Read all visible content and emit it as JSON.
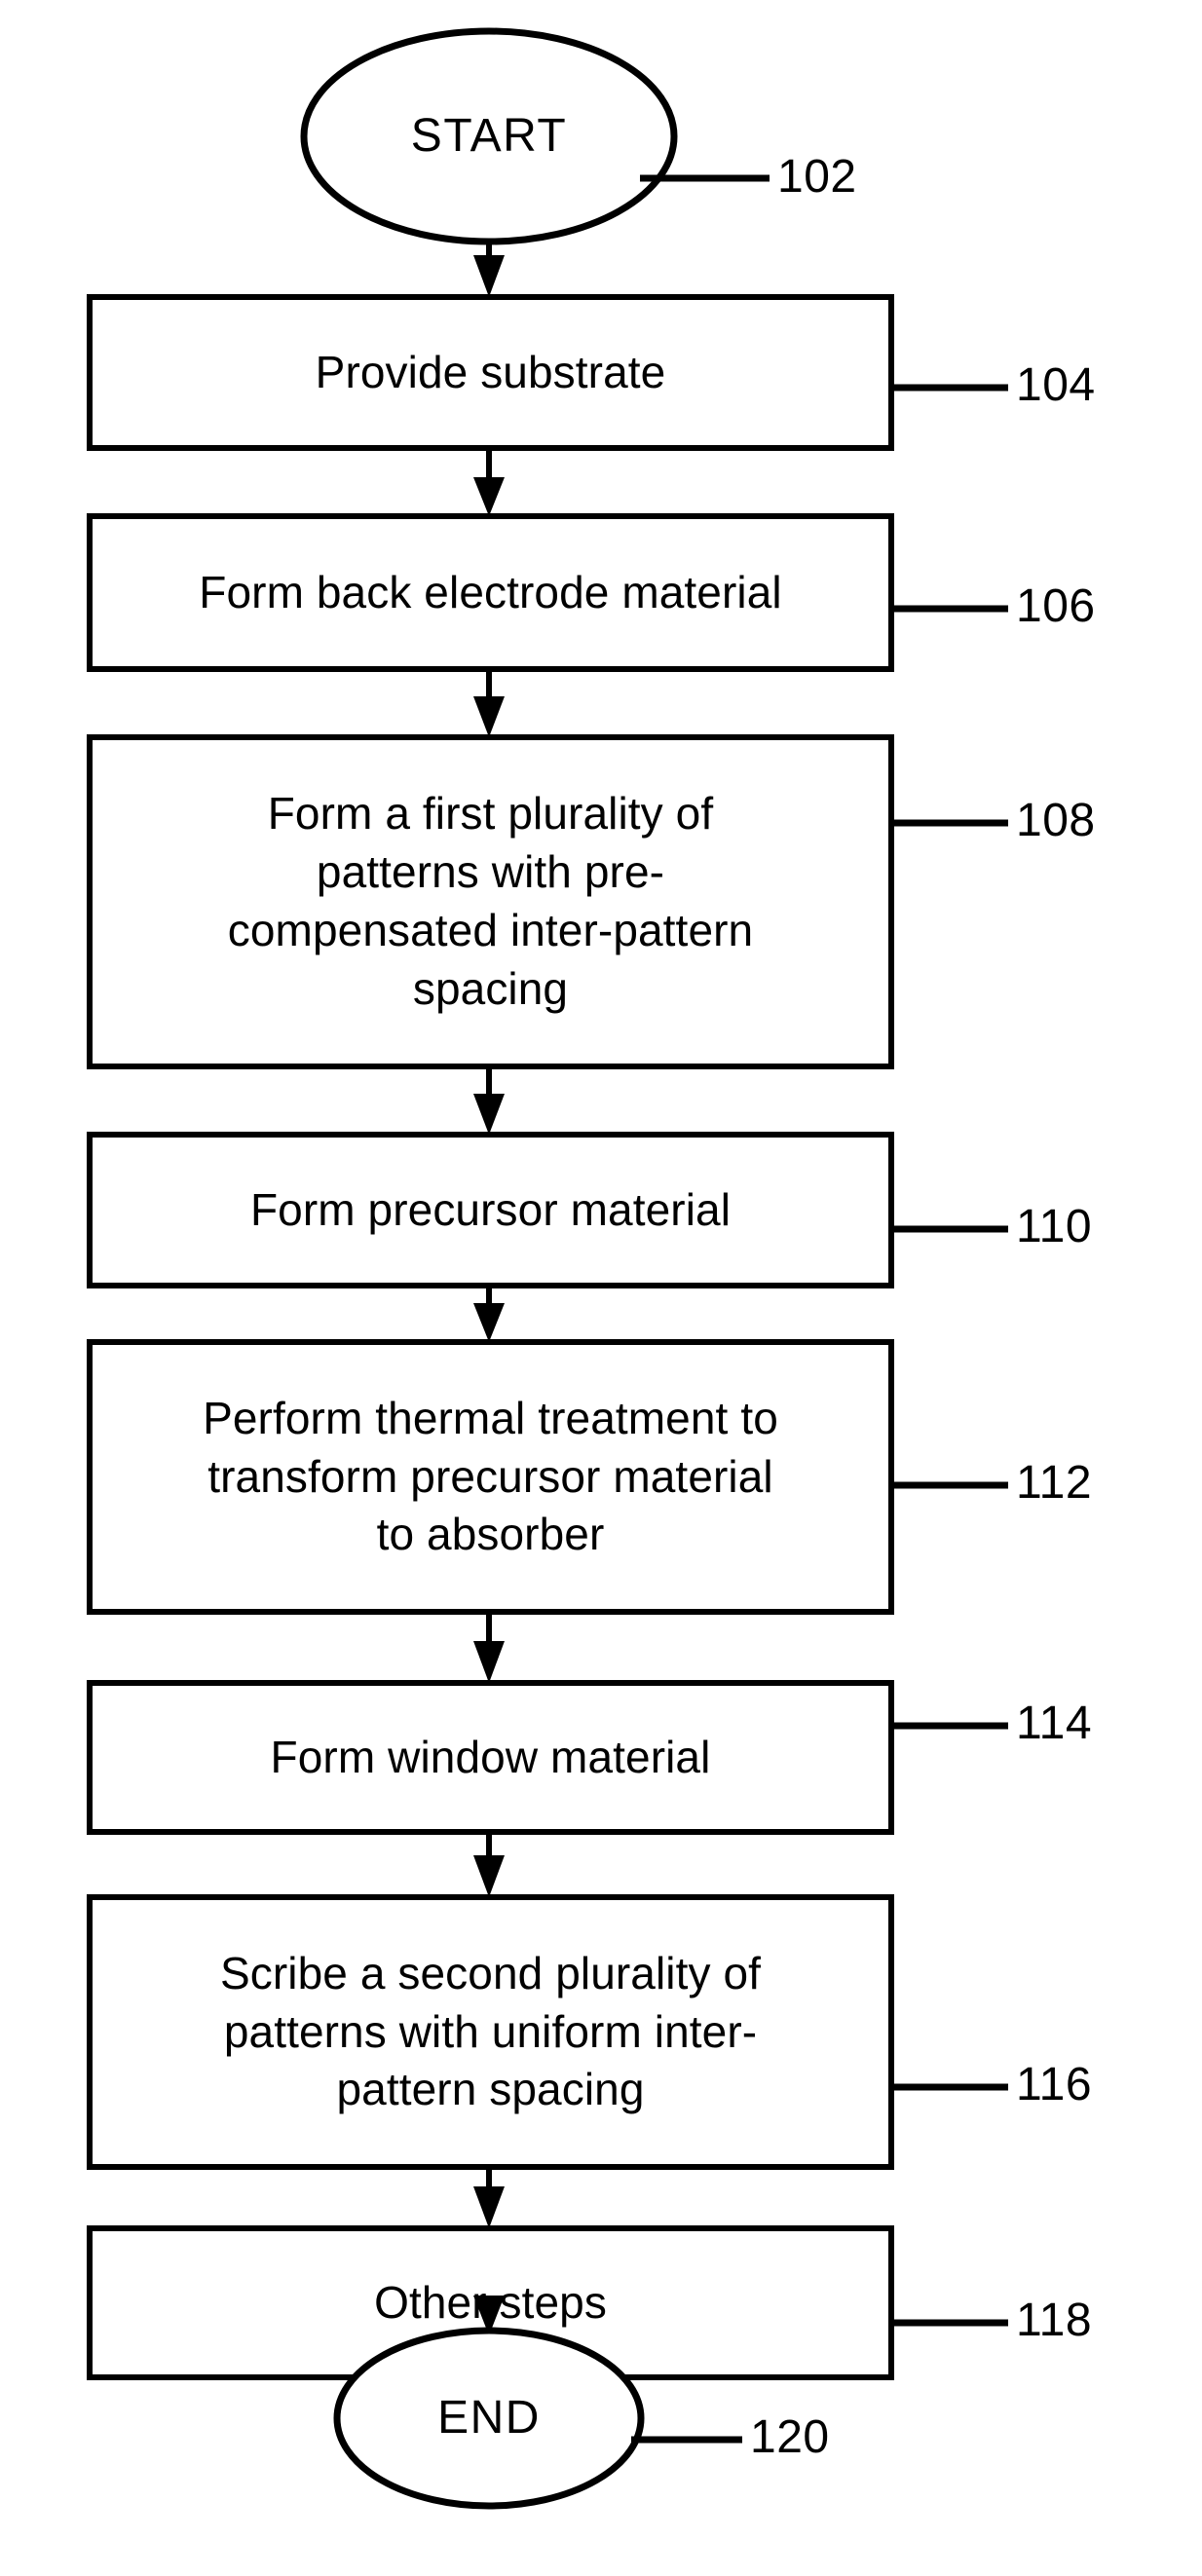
{
  "figure": {
    "type": "process-flowchart",
    "orientation": "vertical-top-to-bottom",
    "background_color": "#ffffff",
    "line_color": "#000000"
  },
  "nodes": [
    {
      "id": "start",
      "shape": "ellipse",
      "label": "START",
      "ref": "102"
    },
    {
      "id": "step-104",
      "shape": "rectangle",
      "label": "Provide substrate",
      "ref": "104"
    },
    {
      "id": "step-106",
      "shape": "rectangle",
      "label": "Form back electrode material",
      "ref": "106"
    },
    {
      "id": "step-108",
      "shape": "rectangle",
      "label": "Form a first plurality of\npatterns with pre-\ncompensated inter-pattern\nspacing",
      "ref": "108"
    },
    {
      "id": "step-110",
      "shape": "rectangle",
      "label": "Form precursor material",
      "ref": "110"
    },
    {
      "id": "step-112",
      "shape": "rectangle",
      "label": "Perform thermal treatment to\ntransform precursor material\nto absorber",
      "ref": "112"
    },
    {
      "id": "step-114",
      "shape": "rectangle",
      "label": "Form window material",
      "ref": "114"
    },
    {
      "id": "step-116",
      "shape": "rectangle",
      "label": "Scribe a second plurality of\npatterns with uniform inter-\npattern spacing",
      "ref": "116"
    },
    {
      "id": "step-118",
      "shape": "rectangle",
      "label": "Other steps",
      "ref": "118"
    },
    {
      "id": "end",
      "shape": "ellipse",
      "label": "END",
      "ref": "120"
    }
  ]
}
